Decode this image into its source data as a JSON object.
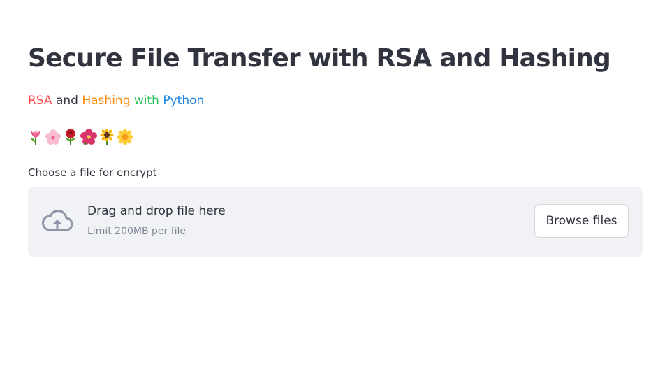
{
  "title": "Secure File Transfer with RSA and Hashing",
  "subtitle": {
    "parts": [
      {
        "text": "RSA",
        "color": "#ff4b4b"
      },
      {
        "text": " and ",
        "color": "#31333f"
      },
      {
        "text": "Hashing",
        "color": "#ff8700"
      },
      {
        "text": " with ",
        "color": "#21c354"
      },
      {
        "text": "Python",
        "color": "#1c83e1"
      }
    ]
  },
  "emojis": [
    "tulip-icon",
    "cherry-blossom-icon",
    "rose-icon",
    "hibiscus-icon",
    "sunflower-icon",
    "blossom-icon"
  ],
  "uploader": {
    "label": "Choose a file for encrypt",
    "drag_text": "Drag and drop file here",
    "limit_text": "Limit 200MB per file",
    "browse_label": "Browse files",
    "icon": "cloud-upload-icon"
  },
  "colors": {
    "text": "#31333f",
    "dropzone_bg": "#f0f2f6",
    "muted_text": "#808495"
  }
}
